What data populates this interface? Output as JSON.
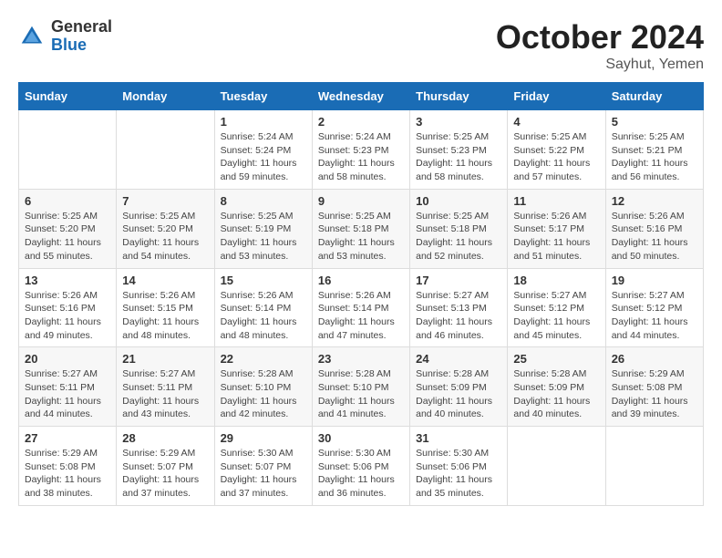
{
  "header": {
    "logo_general": "General",
    "logo_blue": "Blue",
    "month_title": "October 2024",
    "location": "Sayhut, Yemen"
  },
  "weekdays": [
    "Sunday",
    "Monday",
    "Tuesday",
    "Wednesday",
    "Thursday",
    "Friday",
    "Saturday"
  ],
  "weeks": [
    [
      {
        "day": "",
        "info": ""
      },
      {
        "day": "",
        "info": ""
      },
      {
        "day": "1",
        "info": "Sunrise: 5:24 AM\nSunset: 5:24 PM\nDaylight: 11 hours and 59 minutes."
      },
      {
        "day": "2",
        "info": "Sunrise: 5:24 AM\nSunset: 5:23 PM\nDaylight: 11 hours and 58 minutes."
      },
      {
        "day": "3",
        "info": "Sunrise: 5:25 AM\nSunset: 5:23 PM\nDaylight: 11 hours and 58 minutes."
      },
      {
        "day": "4",
        "info": "Sunrise: 5:25 AM\nSunset: 5:22 PM\nDaylight: 11 hours and 57 minutes."
      },
      {
        "day": "5",
        "info": "Sunrise: 5:25 AM\nSunset: 5:21 PM\nDaylight: 11 hours and 56 minutes."
      }
    ],
    [
      {
        "day": "6",
        "info": "Sunrise: 5:25 AM\nSunset: 5:20 PM\nDaylight: 11 hours and 55 minutes."
      },
      {
        "day": "7",
        "info": "Sunrise: 5:25 AM\nSunset: 5:20 PM\nDaylight: 11 hours and 54 minutes."
      },
      {
        "day": "8",
        "info": "Sunrise: 5:25 AM\nSunset: 5:19 PM\nDaylight: 11 hours and 53 minutes."
      },
      {
        "day": "9",
        "info": "Sunrise: 5:25 AM\nSunset: 5:18 PM\nDaylight: 11 hours and 53 minutes."
      },
      {
        "day": "10",
        "info": "Sunrise: 5:25 AM\nSunset: 5:18 PM\nDaylight: 11 hours and 52 minutes."
      },
      {
        "day": "11",
        "info": "Sunrise: 5:26 AM\nSunset: 5:17 PM\nDaylight: 11 hours and 51 minutes."
      },
      {
        "day": "12",
        "info": "Sunrise: 5:26 AM\nSunset: 5:16 PM\nDaylight: 11 hours and 50 minutes."
      }
    ],
    [
      {
        "day": "13",
        "info": "Sunrise: 5:26 AM\nSunset: 5:16 PM\nDaylight: 11 hours and 49 minutes."
      },
      {
        "day": "14",
        "info": "Sunrise: 5:26 AM\nSunset: 5:15 PM\nDaylight: 11 hours and 48 minutes."
      },
      {
        "day": "15",
        "info": "Sunrise: 5:26 AM\nSunset: 5:14 PM\nDaylight: 11 hours and 48 minutes."
      },
      {
        "day": "16",
        "info": "Sunrise: 5:26 AM\nSunset: 5:14 PM\nDaylight: 11 hours and 47 minutes."
      },
      {
        "day": "17",
        "info": "Sunrise: 5:27 AM\nSunset: 5:13 PM\nDaylight: 11 hours and 46 minutes."
      },
      {
        "day": "18",
        "info": "Sunrise: 5:27 AM\nSunset: 5:12 PM\nDaylight: 11 hours and 45 minutes."
      },
      {
        "day": "19",
        "info": "Sunrise: 5:27 AM\nSunset: 5:12 PM\nDaylight: 11 hours and 44 minutes."
      }
    ],
    [
      {
        "day": "20",
        "info": "Sunrise: 5:27 AM\nSunset: 5:11 PM\nDaylight: 11 hours and 44 minutes."
      },
      {
        "day": "21",
        "info": "Sunrise: 5:27 AM\nSunset: 5:11 PM\nDaylight: 11 hours and 43 minutes."
      },
      {
        "day": "22",
        "info": "Sunrise: 5:28 AM\nSunset: 5:10 PM\nDaylight: 11 hours and 42 minutes."
      },
      {
        "day": "23",
        "info": "Sunrise: 5:28 AM\nSunset: 5:10 PM\nDaylight: 11 hours and 41 minutes."
      },
      {
        "day": "24",
        "info": "Sunrise: 5:28 AM\nSunset: 5:09 PM\nDaylight: 11 hours and 40 minutes."
      },
      {
        "day": "25",
        "info": "Sunrise: 5:28 AM\nSunset: 5:09 PM\nDaylight: 11 hours and 40 minutes."
      },
      {
        "day": "26",
        "info": "Sunrise: 5:29 AM\nSunset: 5:08 PM\nDaylight: 11 hours and 39 minutes."
      }
    ],
    [
      {
        "day": "27",
        "info": "Sunrise: 5:29 AM\nSunset: 5:08 PM\nDaylight: 11 hours and 38 minutes."
      },
      {
        "day": "28",
        "info": "Sunrise: 5:29 AM\nSunset: 5:07 PM\nDaylight: 11 hours and 37 minutes."
      },
      {
        "day": "29",
        "info": "Sunrise: 5:30 AM\nSunset: 5:07 PM\nDaylight: 11 hours and 37 minutes."
      },
      {
        "day": "30",
        "info": "Sunrise: 5:30 AM\nSunset: 5:06 PM\nDaylight: 11 hours and 36 minutes."
      },
      {
        "day": "31",
        "info": "Sunrise: 5:30 AM\nSunset: 5:06 PM\nDaylight: 11 hours and 35 minutes."
      },
      {
        "day": "",
        "info": ""
      },
      {
        "day": "",
        "info": ""
      }
    ]
  ]
}
